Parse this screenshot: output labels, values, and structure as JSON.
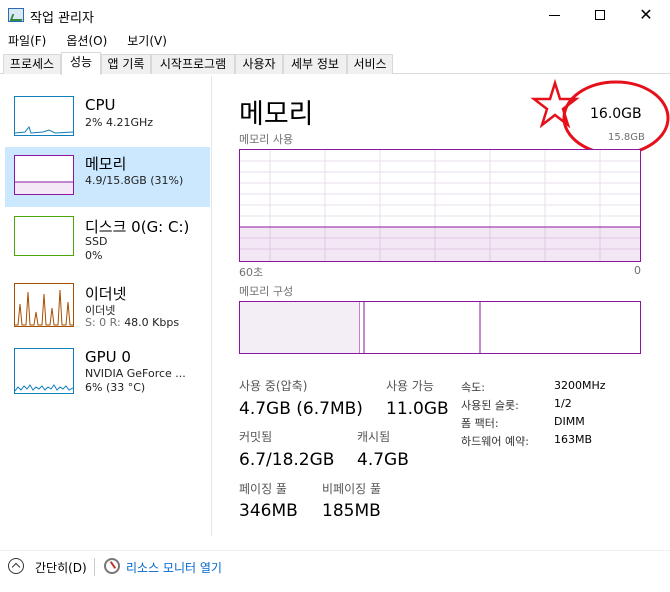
{
  "window": {
    "title": "작업 관리자"
  },
  "menu": [
    "파일(F)",
    "옵션(O)",
    "보기(V)"
  ],
  "tabs": [
    "프로세스",
    "성능",
    "앱 기록",
    "시작프로그램",
    "사용자",
    "세부 정보",
    "서비스"
  ],
  "active_tab": "성능",
  "sidebar": [
    {
      "title": "CPU",
      "line1": "2%  4.21GHz",
      "line2": "",
      "color": "#117dbb"
    },
    {
      "title": "메모리",
      "line1": "4.9/15.8GB (31%)",
      "line2": "",
      "color": "#8b17a1"
    },
    {
      "title": "디스크 0(G: C:)",
      "line1": "SSD",
      "line2": "0%",
      "color": "#4da60c"
    },
    {
      "title": "이더넷",
      "line1": "이더넷",
      "line2_prefix": "S: 0  R: ",
      "line2": "48.0 Kbps",
      "color": "#a74f01"
    },
    {
      "title": "GPU 0",
      "line1": "NVIDIA GeForce ...",
      "line2": "6% (33 °C)",
      "color": "#117dbb"
    }
  ],
  "main": {
    "title": "메모리",
    "capacity_total": "16.0GB",
    "capacity_usable": "15.8GB",
    "usage_label": "메모리 사용",
    "axis_left": "60초",
    "axis_right": "0",
    "composition_label": "메모리 구성",
    "stats": {
      "in_use_label": "사용 중(압축)",
      "in_use_value": "4.7GB (6.7MB)",
      "available_label": "사용 가능",
      "available_value": "11.0GB",
      "committed_label": "커밋됨",
      "committed_value": "6.7/18.2GB",
      "cached_label": "캐시됨",
      "cached_value": "4.7GB",
      "paged_label": "페이징 풀",
      "paged_value": "346MB",
      "nonpaged_label": "비페이징 풀",
      "nonpaged_value": "185MB"
    },
    "info": [
      {
        "label": "속도:",
        "value": "3200MHz"
      },
      {
        "label": "사용된 슬롯:",
        "value": "1/2"
      },
      {
        "label": "폼 팩터:",
        "value": "DIMM"
      },
      {
        "label": "하드웨어 예약:",
        "value": "163MB"
      }
    ]
  },
  "footer": {
    "fewer_details": "간단히(D)",
    "resource_monitor": "리소스 모니터 열기"
  },
  "colors": {
    "memory": "#8b17a1",
    "annotation": "#e5101a"
  },
  "memory_usage_fraction": 0.31,
  "composition": {
    "in_use_fraction": 0.3,
    "modified_fraction": 0.01,
    "standby_fraction": 0.29
  }
}
